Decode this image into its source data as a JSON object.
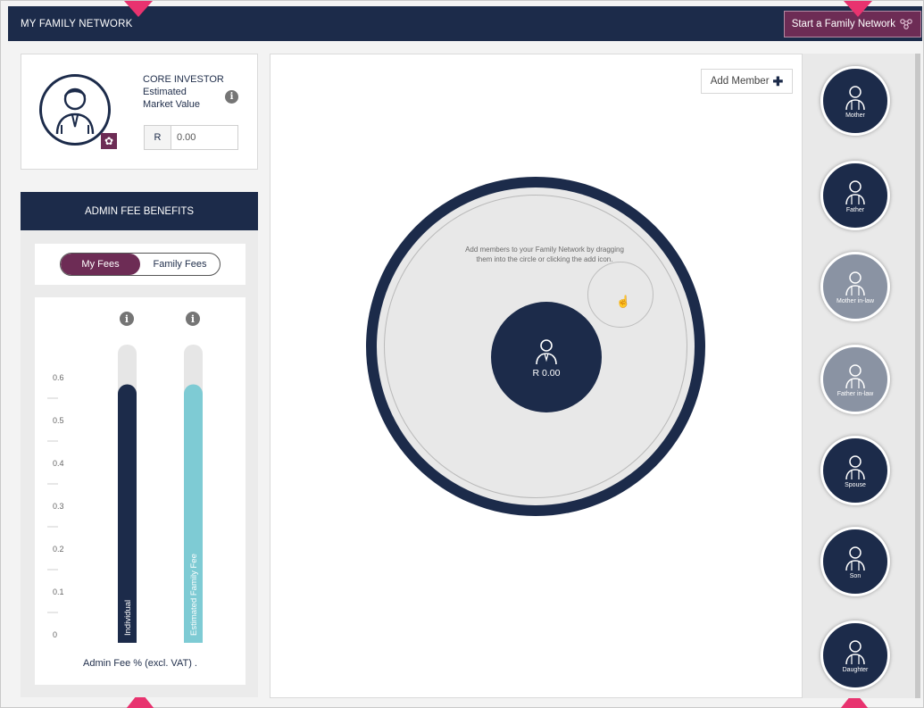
{
  "header": {
    "title": "MY FAMILY NETWORK",
    "start_network_label": "Start a Family Network"
  },
  "investor": {
    "role": "CORE INVESTOR",
    "value_label": "Estimated Market Value",
    "currency": "R",
    "value": "0.00"
  },
  "admin": {
    "heading": "ADMIN FEE BENEFITS",
    "toggle": {
      "my_fees": "My Fees",
      "family_fees": "Family Fees",
      "selected": "My Fees"
    },
    "axis_label": "Admin Fee % (excl. VAT) ."
  },
  "chart_data": {
    "type": "bar",
    "orientation": "vertical",
    "categories": [
      "Individual",
      "Estimated Family Fee"
    ],
    "values": [
      0.55,
      0.55
    ],
    "colors": [
      "#1c2b4a",
      "#7ecbd4"
    ],
    "track_color": "#e6e6e6",
    "yticks": [
      "0.6",
      "0.5",
      "0.4",
      "0.3",
      "0.2",
      "0.1",
      "0"
    ],
    "ylim": [
      0,
      0.65
    ],
    "xlabel": "Admin Fee % (excl. VAT) ."
  },
  "network": {
    "add_member_label": "Add Member",
    "hint": "Add members to your Family Network by dragging them into the circle or clicking the add icon.",
    "core_amount": "R 0.00"
  },
  "members": [
    {
      "label": "Mother",
      "active": true
    },
    {
      "label": "Father",
      "active": true
    },
    {
      "label": "Mother in-law",
      "active": false
    },
    {
      "label": "Father in-law",
      "active": false
    },
    {
      "label": "Spouse",
      "active": true
    },
    {
      "label": "Son",
      "active": true
    },
    {
      "label": "Daughter",
      "active": true
    }
  ],
  "colors": {
    "navy": "#1c2b4a",
    "plum": "#6d2c55",
    "teal": "#7ecbd4",
    "pointer": "#e8336f"
  }
}
